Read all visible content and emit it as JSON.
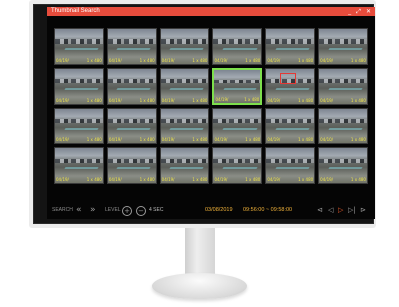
{
  "window": {
    "title": "Thumbnail Search",
    "buttons": [
      "_",
      "⤢",
      "✕"
    ]
  },
  "thumbnails": [
    {
      "date": "04/19/",
      "range": "1 x 480"
    },
    {
      "date": "04/19/",
      "range": "1 x 480"
    },
    {
      "date": "04/19/",
      "range": "1 x 480"
    },
    {
      "date": "04/19/",
      "range": "1 x 480"
    },
    {
      "date": "04/19/",
      "range": "1 x 480"
    },
    {
      "date": "04/19/",
      "range": "1 x 480"
    },
    {
      "date": "04/19/",
      "range": "1 x 480"
    },
    {
      "date": "04/19/",
      "range": "1 x 480"
    },
    {
      "date": "04/19/",
      "range": "1 x 480"
    },
    {
      "date": "04/19/",
      "range": "1 x 480",
      "selected": true
    },
    {
      "date": "04/19/",
      "range": "1 x 480",
      "highlighted": true
    },
    {
      "date": "04/19/",
      "range": "1 x 480"
    },
    {
      "date": "04/19/",
      "range": "1 x 480"
    },
    {
      "date": "04/19/",
      "range": "1 x 480"
    },
    {
      "date": "04/19/",
      "range": "1 x 480"
    },
    {
      "date": "04/19/",
      "range": "1 x 480"
    },
    {
      "date": "04/19/",
      "range": "1 x 480"
    },
    {
      "date": "04/10/",
      "range": "1 x 480"
    },
    {
      "date": "04/19/",
      "range": "1 x 480"
    },
    {
      "date": "04/19/",
      "range": "1 x 480"
    },
    {
      "date": "04/19/",
      "range": "1 x 480"
    },
    {
      "date": "04/19/",
      "range": "1 x 480"
    },
    {
      "date": "04/19/",
      "range": "1 x 480"
    },
    {
      "date": "04/19/",
      "range": "1 x 480"
    }
  ],
  "controls": {
    "search_label": "SEARCH",
    "prev_icon": "«",
    "next_icon": "»",
    "level_label": "LEVEL",
    "level_plus": "+",
    "level_minus": "−",
    "interval_label": "4 SEC",
    "date": "03/08/2019",
    "time_range": "09:56:00 ~ 09:58:00",
    "playback": [
      "⊲",
      "◁",
      "▷",
      "▷|",
      "⊳"
    ]
  },
  "colors": {
    "titlebar": "#e74c3c",
    "thumb_label": "#f1e64a",
    "selected_border": "#7ddf4c",
    "highlight_box": "#e53935",
    "datetime_text": "#f0b23a",
    "play_button": "#e55a2b"
  }
}
